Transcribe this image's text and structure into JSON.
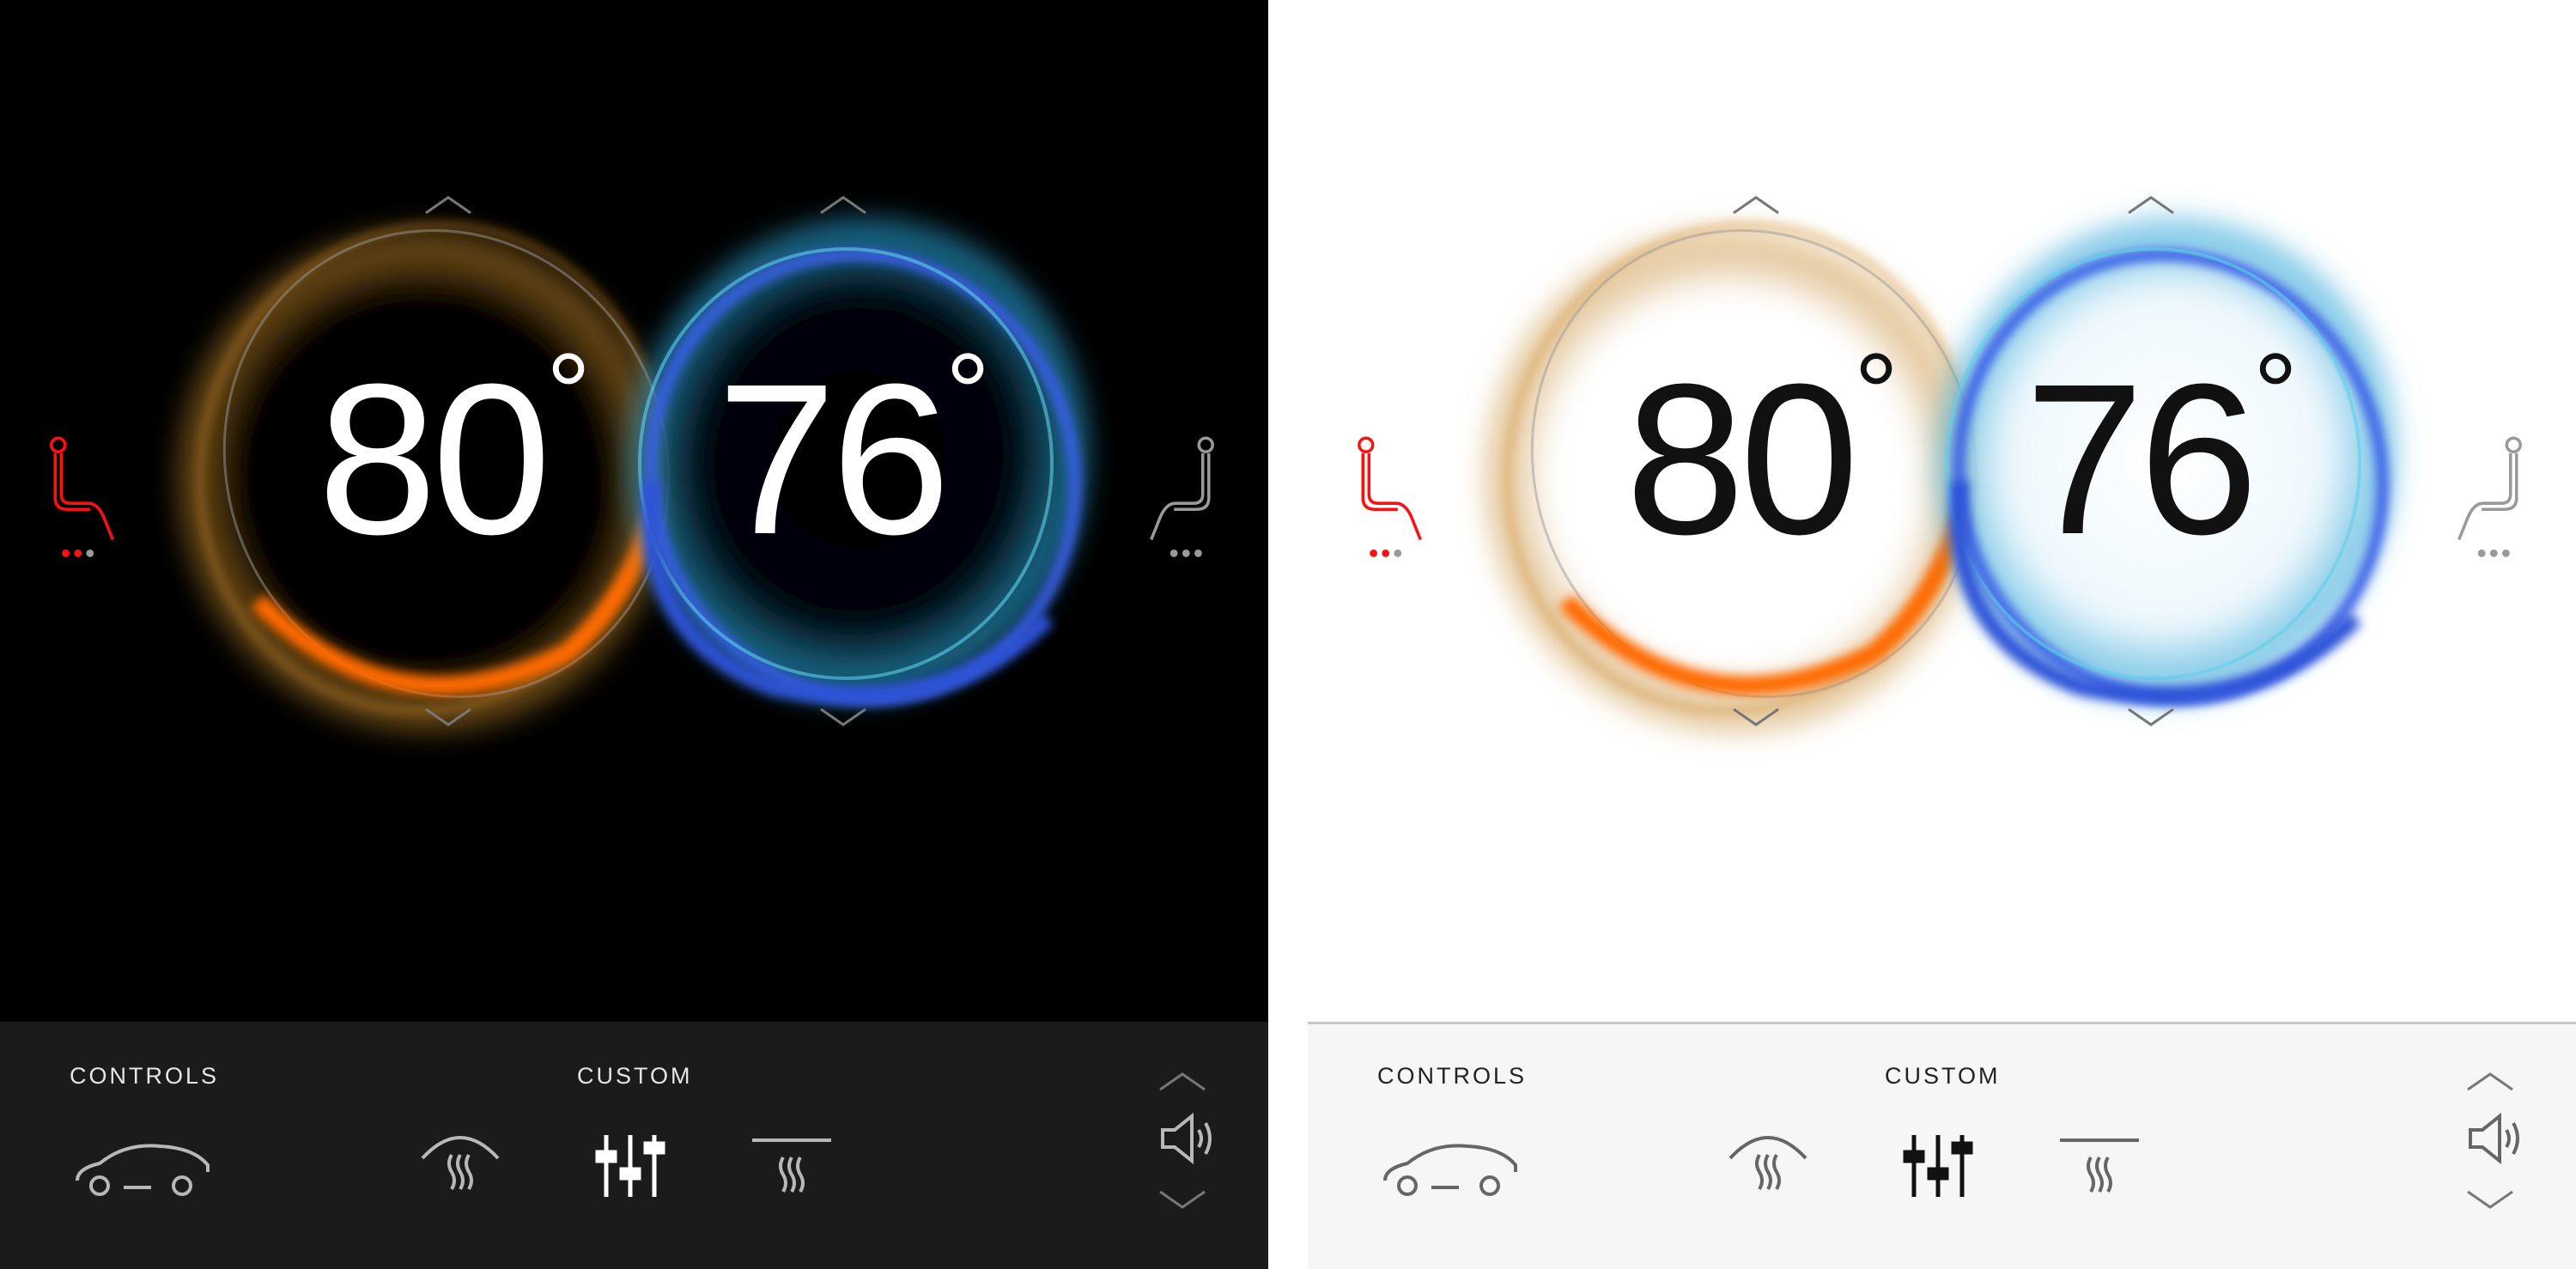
{
  "panels": [
    {
      "theme": "dark",
      "driver_temp": "80",
      "passenger_temp": "76",
      "degree": "°",
      "driver_seat_heat_level": 2,
      "passenger_seat_heat_level": 0,
      "controls_label": "CONTROLS",
      "custom_label": "CUSTOM",
      "colors": {
        "background": "#000000",
        "bar": "#1b1b1b",
        "warm": "#ff7a00",
        "cool": "#3a5ee8",
        "seat_active": "#ff0000"
      }
    },
    {
      "theme": "light",
      "driver_temp": "80",
      "passenger_temp": "76",
      "degree": "°",
      "driver_seat_heat_level": 2,
      "passenger_seat_heat_level": 0,
      "controls_label": "CONTROLS",
      "custom_label": "CUSTOM",
      "colors": {
        "background": "#ffffff",
        "bar": "#f6f6f6",
        "warm": "#ff7a00",
        "cool": "#3a5ee8",
        "seat_active": "#ff0000"
      }
    }
  ]
}
